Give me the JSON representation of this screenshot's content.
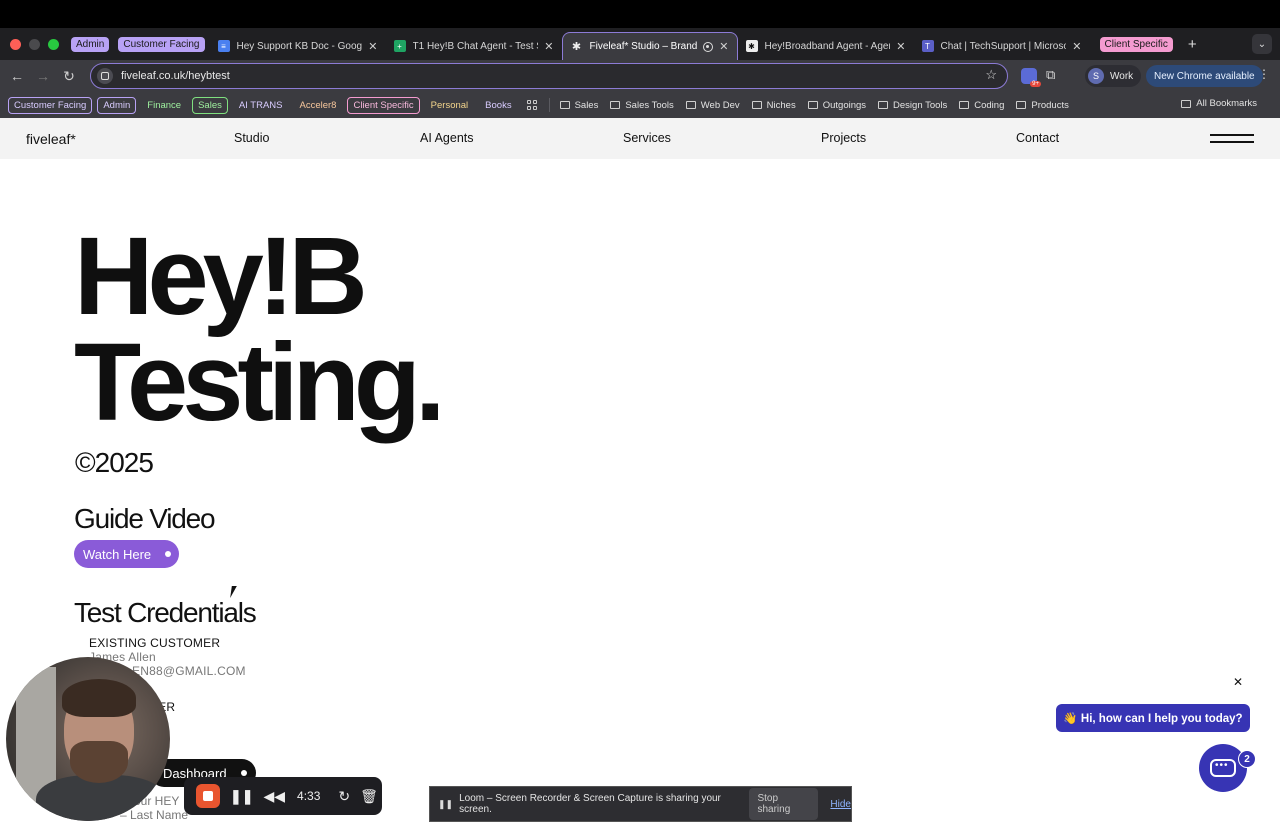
{
  "browser": {
    "tab_groups": {
      "admin": {
        "label": "Admin",
        "color": "#b8a2f5"
      },
      "customer_facing": {
        "label": "Customer Facing",
        "color": "#b8a2f5"
      },
      "client_specific": {
        "label": "Client Specific",
        "color": "#f49bd0"
      }
    },
    "tabs": [
      {
        "title": "Hey Support KB Doc - Google",
        "icon": "google-docs-icon"
      },
      {
        "title": "T1 Hey!B Chat Agent - Test S",
        "icon": "google-sheets-icon"
      },
      {
        "title": "Fiveleaf* Studio – Brandin",
        "icon": "fiveleaf-icon",
        "active": true
      },
      {
        "title": "Hey!Broadband Agent - Agen",
        "icon": "agent-icon"
      },
      {
        "title": "Chat | TechSupport | Microso",
        "icon": "teams-icon"
      }
    ],
    "url": "fiveleaf.co.uk/heybtest",
    "profile": {
      "initial": "S",
      "label": "Work"
    },
    "update_label": "New Chrome available",
    "bookmarks": {
      "chips": [
        {
          "label": "Customer Facing",
          "color": "#b8a2f5"
        },
        {
          "label": "Admin",
          "color": "#b8a2f5"
        },
        {
          "label": "Finance",
          "color": "#7fe07f"
        },
        {
          "label": "Sales",
          "color": "#7fe07f"
        },
        {
          "label": "AI TRANS",
          "color": "#b8a2f5"
        },
        {
          "label": "Acceler8",
          "color": "#f3b07a"
        },
        {
          "label": "Client Specific",
          "color": "#f49bd0"
        },
        {
          "label": "Personal",
          "color": "#f3c96a"
        },
        {
          "label": "Books",
          "color": "#b8a2f5"
        }
      ],
      "folders": [
        "Sales",
        "Sales Tools",
        "Web Dev",
        "Niches",
        "Outgoings",
        "Design Tools",
        "Coding",
        "Products"
      ],
      "all_label": "All Bookmarks"
    }
  },
  "site": {
    "logo": "fiveleaf*",
    "nav": [
      "Studio",
      "AI Agents",
      "Services",
      "Projects",
      "Contact"
    ]
  },
  "main": {
    "hero_line1": "Hey!B",
    "hero_line2": "Testing.",
    "copyright": "©2025",
    "guide_heading": "Guide Video",
    "watch_label": "Watch Here",
    "credentials_heading": "Test Credentials",
    "existing_label": "EXISTING CUSTOMER",
    "existing_name": "James Allen",
    "existing_email": "EN88@GMAIL.COM",
    "new_label": "MER",
    "dashboard_label": "Dashboard",
    "field1": "our HEY",
    "field2": "– Last Name"
  },
  "loom": {
    "time": "4:33",
    "share_text": "Loom – Screen Recorder & Screen Capture is sharing your screen.",
    "stop_label": "Stop sharing",
    "hide_label": "Hide"
  },
  "chat": {
    "greeting": "👋 Hi, how can I help you today?",
    "badge": "2"
  }
}
